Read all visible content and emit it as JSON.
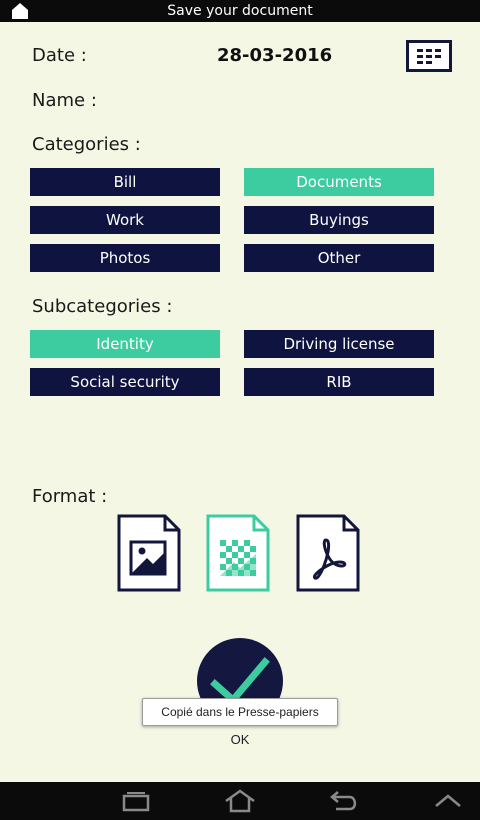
{
  "app": {
    "title": "Save your document"
  },
  "date": {
    "label": "Date :",
    "value": "28-03-2016"
  },
  "name": {
    "label": "Name :"
  },
  "categories": {
    "label": "Categories :",
    "items": [
      {
        "label": "Bill",
        "selected": false
      },
      {
        "label": "Documents",
        "selected": true
      },
      {
        "label": "Work",
        "selected": false
      },
      {
        "label": "Buyings",
        "selected": false
      },
      {
        "label": "Photos",
        "selected": false
      },
      {
        "label": "Other",
        "selected": false
      }
    ]
  },
  "subcategories": {
    "label": "Subcategories :",
    "items": [
      {
        "label": "Identity",
        "selected": true
      },
      {
        "label": "Driving license",
        "selected": false
      },
      {
        "label": "Social security",
        "selected": false
      },
      {
        "label": "RIB",
        "selected": false
      }
    ]
  },
  "format": {
    "label": "Format :",
    "options": [
      {
        "icon": "image-file-icon",
        "selected": false
      },
      {
        "icon": "mosaic-file-icon",
        "selected": true
      },
      {
        "icon": "pdf-file-icon",
        "selected": false
      }
    ]
  },
  "toast": {
    "message": "Copié dans le Presse-papiers"
  },
  "dialog": {
    "ok_label": "OK"
  },
  "colors": {
    "navy": "#0f1340",
    "accent": "#3ccc9f",
    "background": "#f3f7e4"
  }
}
